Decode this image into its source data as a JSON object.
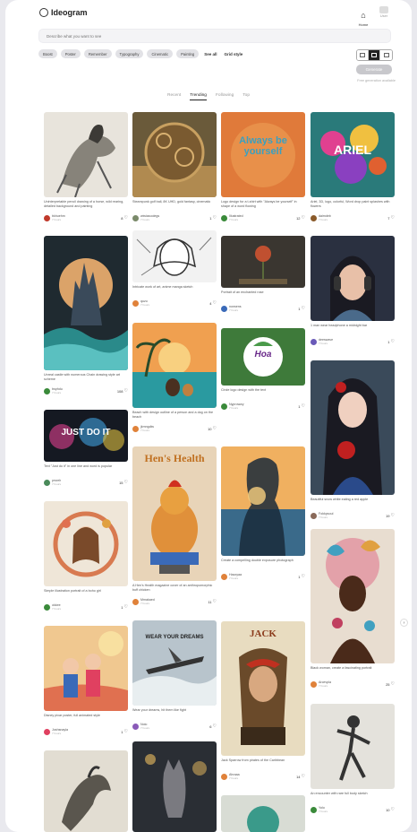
{
  "app": {
    "logo_text": "Ideogram"
  },
  "nav": {
    "home_label": "Home",
    "profile_label": "User"
  },
  "search": {
    "placeholder": "Describe what you want to see"
  },
  "chips": [
    "Boost",
    "Poster",
    "Remember",
    "Typography",
    "Cinematic",
    "Painting"
  ],
  "chip_links": {
    "see_all": "See all",
    "tags": "Grid style"
  },
  "generate_label": "Generate",
  "credits_text": "Free generation available",
  "tabs": [
    "Recent",
    "Trending",
    "Following",
    "Top"
  ],
  "active_tab": "Trending",
  "cards": [
    {
      "id": "horse",
      "prompt": "Uninterpretable pencil drawing of a horse, wild rearing, detailed background and painting",
      "user": "bkhuehm",
      "sub": "7 hours",
      "likes": "8",
      "avatar": "#c0392b"
    },
    {
      "id": "steampunk",
      "prompt": "Steampunk golf ball, 8K UHD, gold fantasy, cinematic",
      "user": "wiwiasoolegs",
      "sub": "7 hours",
      "likes": "1",
      "avatar": "#7a8a6a"
    },
    {
      "id": "always",
      "prompt": "Logo design for a t-shirt with \"Always be yourself\" in shape of a word flowing",
      "user": "Illustrated",
      "sub": "7 hours",
      "likes": "12",
      "avatar": "#3a8a3a",
      "image_text": "Always be yourself"
    },
    {
      "id": "ariel",
      "prompt": "Ariel, 3D, logo, colorful, Word drop paint splashes with flowers",
      "user": "daimdeb",
      "sub": "7 hours",
      "likes": "7",
      "avatar": "#8a5a2a",
      "image_text": "ARIEL"
    },
    {
      "id": "castle",
      "prompt": "Unreal castle with numerous Chain drawing style art scheme",
      "user": "bsphdu",
      "sub": "7 hours",
      "likes": "108",
      "avatar": "#3a8a3a"
    },
    {
      "id": "manga",
      "prompt": "Intricate work of art, anime manga sketch",
      "user": "quzu",
      "sub": "7 hours",
      "likes": "4",
      "avatar": "#e0823a"
    },
    {
      "id": "rose",
      "prompt": "Portrait of an enchanted rose",
      "user": "nonsens",
      "sub": "7 hours",
      "likes": "1",
      "avatar": "#3a6ab8"
    },
    {
      "id": "headphones",
      "prompt": "1 man wear headphone a midnight bar",
      "user": "deeswave",
      "sub": "7 hours",
      "likes": "1",
      "avatar": "#6a5ab8"
    },
    {
      "id": "beach",
      "prompt": "Beach with design outline of a person and a dog on the beach",
      "user": "jkmngdiw",
      "sub": "7 hours",
      "likes": "10",
      "avatar": "#e0823a"
    },
    {
      "id": "hoa",
      "prompt": "Circle logo design with the text",
      "user": "Nyprowwy",
      "sub": "7 hours",
      "likes": "1",
      "avatar": "#3a8a3a",
      "image_text": "Hoa"
    },
    {
      "id": "justdoit",
      "prompt": "Text \"Just do it\" in one line and word is popular",
      "user": "prsreh",
      "sub": "7 hours",
      "likes": "15",
      "avatar": "#4a8a5a",
      "image_text": "JUST DO IT"
    },
    {
      "id": "apple",
      "prompt": "Beautiful snow white eating a red apple",
      "user": "Fokkpsoul",
      "sub": "7 hours",
      "likes": "19",
      "avatar": "#8a6a5a"
    },
    {
      "id": "hens",
      "prompt": "A Hen's Health magazine cover of an anthropomorphic buff chicken",
      "user": "Mmakaed",
      "sub": "7 hours",
      "likes": "11",
      "avatar": "#e0823a",
      "image_text": "Hen's Health"
    },
    {
      "id": "silhouette",
      "prompt": "Create a compelling double exposure photograph",
      "user": "Hazzyaa",
      "sub": "7 hours",
      "likes": "1",
      "avatar": "#e0823a"
    },
    {
      "id": "flowergirl",
      "prompt": "Simple illustration portrait of a boho girl",
      "user": "okkee",
      "sub": "7 hours",
      "likes": "1",
      "avatar": "#3a8a3a"
    },
    {
      "id": "butterfly",
      "prompt": "Black woman, create a fascinating portrait",
      "user": "Arcevpla",
      "sub": "7 hours",
      "likes": "25",
      "avatar": "#e0823a"
    },
    {
      "id": "family",
      "prompt": "Disney pixar poster, full animated style",
      "user": "Joshsnayla",
      "sub": "7 hours",
      "likes": "1",
      "avatar": "#e04060"
    },
    {
      "id": "dreams",
      "prompt": "Wear your dreams, hit them like fight",
      "user": "Nolo",
      "sub": "7 hours",
      "likes": "6",
      "avatar": "#8a5ab8",
      "image_text": "WEAR YOUR DREAMS"
    },
    {
      "id": "jack",
      "prompt": "Jack Sparrow from pirates of the Caribbean",
      "user": "Ahraaa",
      "sub": "7 hours",
      "likes": "14",
      "avatar": "#e0823a",
      "image_text": "JACK"
    },
    {
      "id": "dancer",
      "prompt": "An encounter with rare full body sketch",
      "user": "Yolo",
      "sub": "7 hours",
      "likes": "10",
      "avatar": "#3a8a3a"
    },
    {
      "id": "dragon",
      "prompt": "",
      "user": "",
      "sub": "",
      "likes": "",
      "avatar": "#999"
    },
    {
      "id": "cat",
      "prompt": "",
      "user": "",
      "sub": "",
      "likes": "",
      "avatar": "#999"
    }
  ]
}
